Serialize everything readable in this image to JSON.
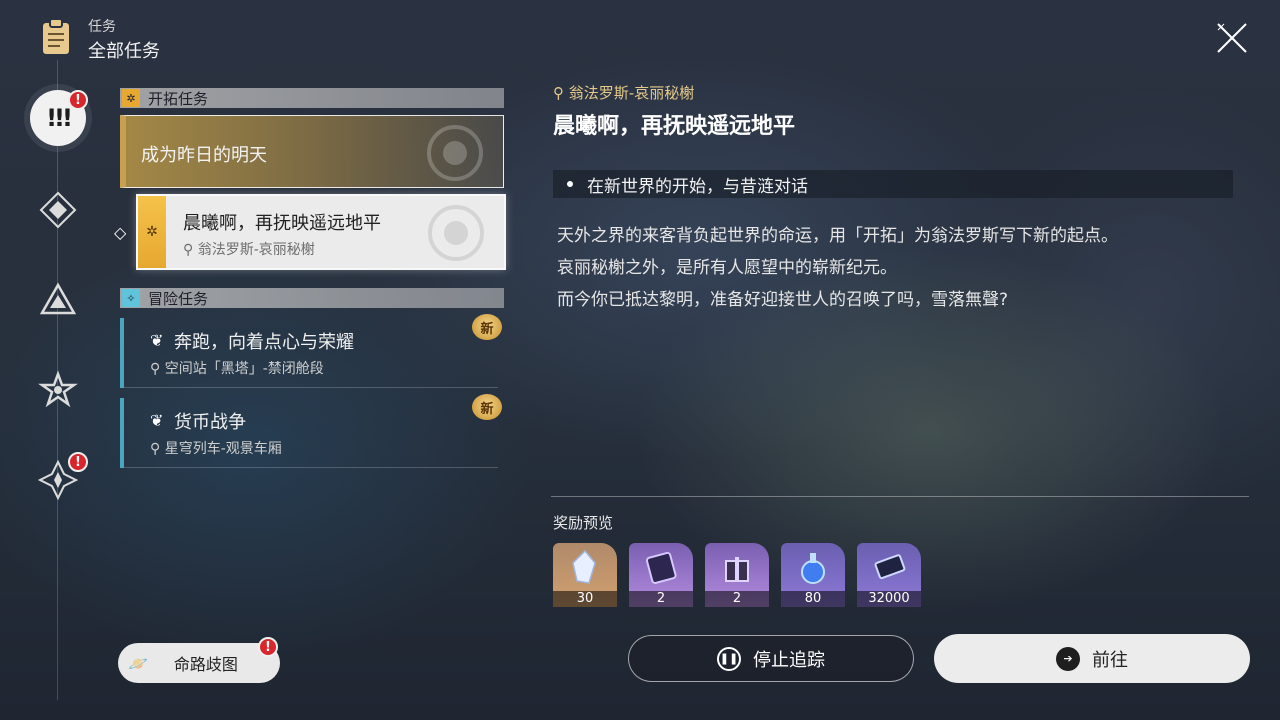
{
  "header": {
    "category": "任务",
    "title": "全部任务"
  },
  "rail": {
    "badges": [
      "!",
      "!"
    ]
  },
  "sections": {
    "trailblaze": {
      "label": "开拓任务"
    },
    "adventure": {
      "label": "冒险任务"
    }
  },
  "quests": {
    "completed": {
      "title": "成为昨日的明天"
    },
    "selected": {
      "title": "晨曦啊，再抚映遥远地平",
      "location": "翁法罗斯-哀丽秘榭"
    },
    "adventure": [
      {
        "title": "奔跑，向着点心与荣耀",
        "location": "空间站「黑塔」-禁闭舱段",
        "new": "新"
      },
      {
        "title": "货币战争",
        "location": "星穹列车-观景车厢",
        "new": "新"
      }
    ]
  },
  "detail": {
    "location": "翁法罗斯-哀丽秘榭",
    "title": "晨曦啊，再抚映遥远地平",
    "objective": "在新世界的开始，与昔涟对话",
    "description": [
      "天外之界的来客背负起世界的命运，用「开拓」为翁法罗斯写下新的起点。",
      "哀丽秘榭之外，是所有人愿望中的崭新纪元。",
      "而今你已抵达黎明，准备好迎接世人的召唤了吗，雪落無聲?"
    ]
  },
  "rewards": {
    "label": "奖励预览",
    "items": [
      {
        "count": "30",
        "icon": "crystal-icon"
      },
      {
        "count": "2",
        "icon": "pass-icon"
      },
      {
        "count": "2",
        "icon": "gift-box-icon"
      },
      {
        "count": "80",
        "icon": "potion-icon"
      },
      {
        "count": "32000",
        "icon": "credit-icon"
      }
    ]
  },
  "buttons": {
    "map": "命路歧图",
    "map_badge": "!",
    "stop": "停止追踪",
    "go": "前往"
  },
  "colors": {
    "accent_gold": "#e6a830",
    "adventure_teal": "#4aa6bf",
    "alert_red": "#d7262c"
  }
}
